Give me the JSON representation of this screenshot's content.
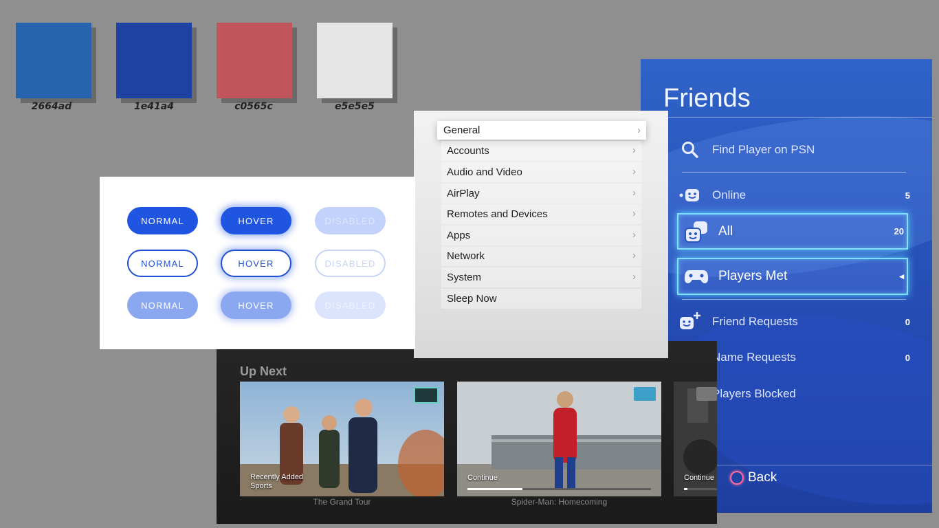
{
  "swatches": [
    {
      "label": "2664ad",
      "color": "#2664ad"
    },
    {
      "label": "1e41a4",
      "color": "#1e41a4"
    },
    {
      "label": "c0565c",
      "color": "#c0565c"
    },
    {
      "label": "e5e5e5",
      "color": "#e5e5e5"
    }
  ],
  "friends": {
    "title": "Friends",
    "search_label": "Find Player on PSN",
    "items": [
      {
        "label": "Online",
        "count": "5"
      },
      {
        "label": "All",
        "count": "20"
      },
      {
        "label": "Players Met",
        "count": "◂"
      },
      {
        "label": "Friend Requests",
        "count": "0"
      },
      {
        "label": "Name Requests",
        "count": "0"
      },
      {
        "label": "Players Blocked",
        "count": ""
      }
    ],
    "back_label": "Back"
  },
  "settings": {
    "items": [
      {
        "label": "General"
      },
      {
        "label": "Accounts"
      },
      {
        "label": "Audio and Video"
      },
      {
        "label": "AirPlay"
      },
      {
        "label": "Remotes and Devices"
      },
      {
        "label": "Apps"
      },
      {
        "label": "Network"
      },
      {
        "label": "System"
      },
      {
        "label": "Sleep Now"
      }
    ],
    "chevron": "›"
  },
  "buttons": {
    "rows": [
      [
        "NORMAL",
        "HOVER",
        "DISABLED"
      ],
      [
        "NORMAL",
        "HOVER",
        "DISABLED"
      ],
      [
        "NORMAL",
        "HOVER",
        "DISABLED"
      ]
    ]
  },
  "upnext": {
    "title": "Up Next",
    "cards": [
      {
        "caption_line1": "Recently Added",
        "caption_line2": "Sports",
        "title": "The Grand Tour",
        "progress": 0
      },
      {
        "caption_line1": "Continue",
        "caption_line2": "",
        "title": "Spider-Man: Homecoming",
        "progress": 0.3
      },
      {
        "caption_line1": "Continue",
        "caption_line2": "",
        "title": "",
        "progress": 0.1
      }
    ]
  }
}
